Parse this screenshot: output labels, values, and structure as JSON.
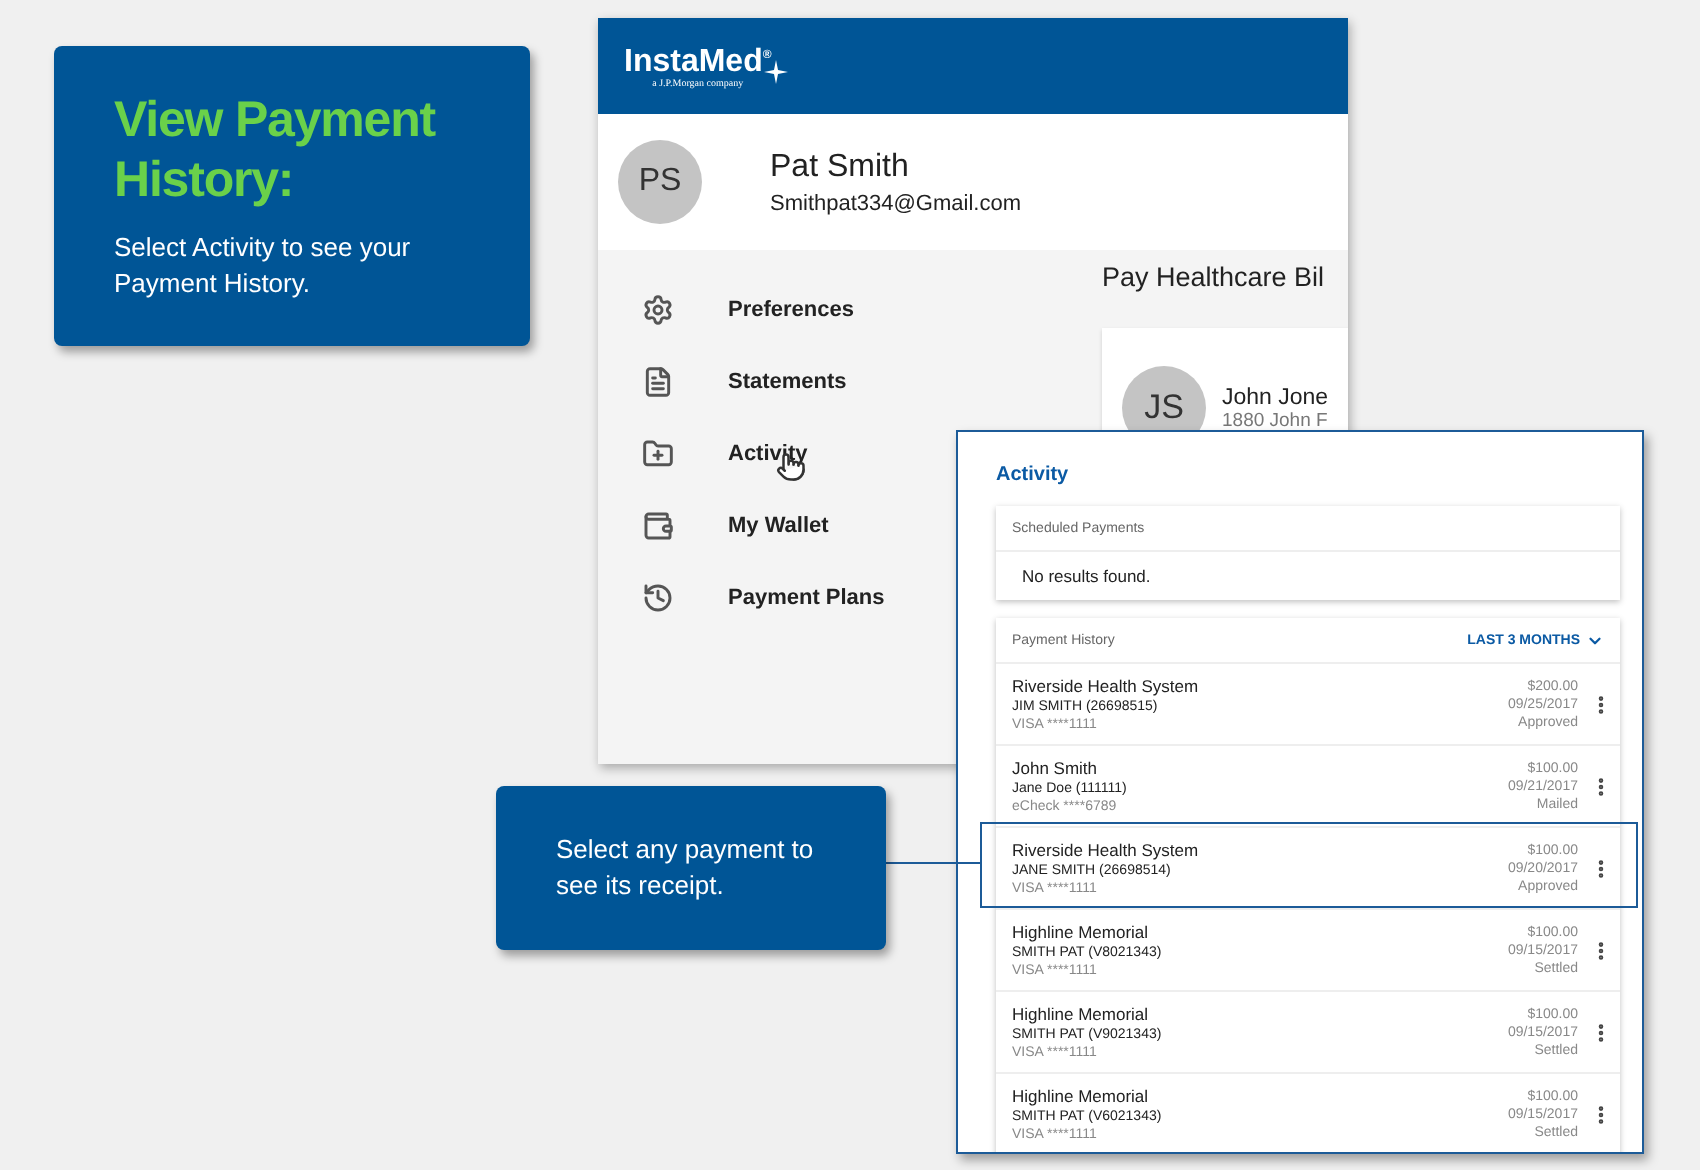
{
  "callouts": [
    {
      "title": "View Payment History:",
      "text": "Select Activity to see your Payment History."
    },
    {
      "text": "Select any payment to see its receipt."
    }
  ],
  "app": {
    "logo": {
      "name": "InstaMed$^{®}$",
      "tagline": "a J.P.Morgan company"
    },
    "profile": {
      "initials": "PS",
      "name": "Pat Smith",
      "email": "Smithpat334@Gmail.com"
    },
    "sidebar": {
      "items": [
        {
          "label": "Preferences",
          "kind": "gear"
        },
        {
          "label": "Statements",
          "kind": "document"
        },
        {
          "label": "Activity",
          "kind": "folder"
        },
        {
          "label": "My Wallet",
          "kind": "wallet"
        },
        {
          "label": "Payment Plans",
          "kind": "history"
        }
      ]
    },
    "main": {
      "title": "Pay Healthcare Bil",
      "account": {
        "initials": "JS",
        "name": "John Jone",
        "address": "1880 John F"
      }
    }
  },
  "activity": {
    "title": "Activity",
    "scheduled": {
      "title": "Scheduled Payments",
      "empty": "No results found."
    },
    "history": {
      "title": "Payment History",
      "filter": "LAST 3 MONTHS",
      "rows": [
        {
          "payee": "Riverside Health System",
          "patient": "JIM SMITH (26698515)",
          "method": "VISA ****1111",
          "amount": "$200.00",
          "date": "09/25/2017",
          "status": "Approved",
          "selected": false
        },
        {
          "payee": "John Smith",
          "patient": "Jane Doe (111111)",
          "method": "eCheck ****6789",
          "amount": "$100.00",
          "date": "09/21/2017",
          "status": "Mailed",
          "selected": false
        },
        {
          "payee": "Riverside Health System",
          "patient": "JANE SMITH (26698514)",
          "method": "VISA ****1111",
          "amount": "$100.00",
          "date": "09/20/2017",
          "status": "Approved",
          "selected": true
        },
        {
          "payee": "Highline Memorial",
          "patient": "SMITH PAT (V8021343)",
          "method": "VISA ****1111",
          "amount": "$100.00",
          "date": "09/15/2017",
          "status": "Settled",
          "selected": false
        },
        {
          "payee": "Highline Memorial",
          "patient": "SMITH PAT (V9021343)",
          "method": "VISA ****1111",
          "amount": "$100.00",
          "date": "09/15/2017",
          "status": "Settled",
          "selected": false
        },
        {
          "payee": "Highline Memorial",
          "patient": "SMITH PAT (V6021343)",
          "method": "VISA ****1111",
          "amount": "$100.00",
          "date": "09/15/2017",
          "status": "Settled",
          "selected": false
        }
      ]
    }
  }
}
